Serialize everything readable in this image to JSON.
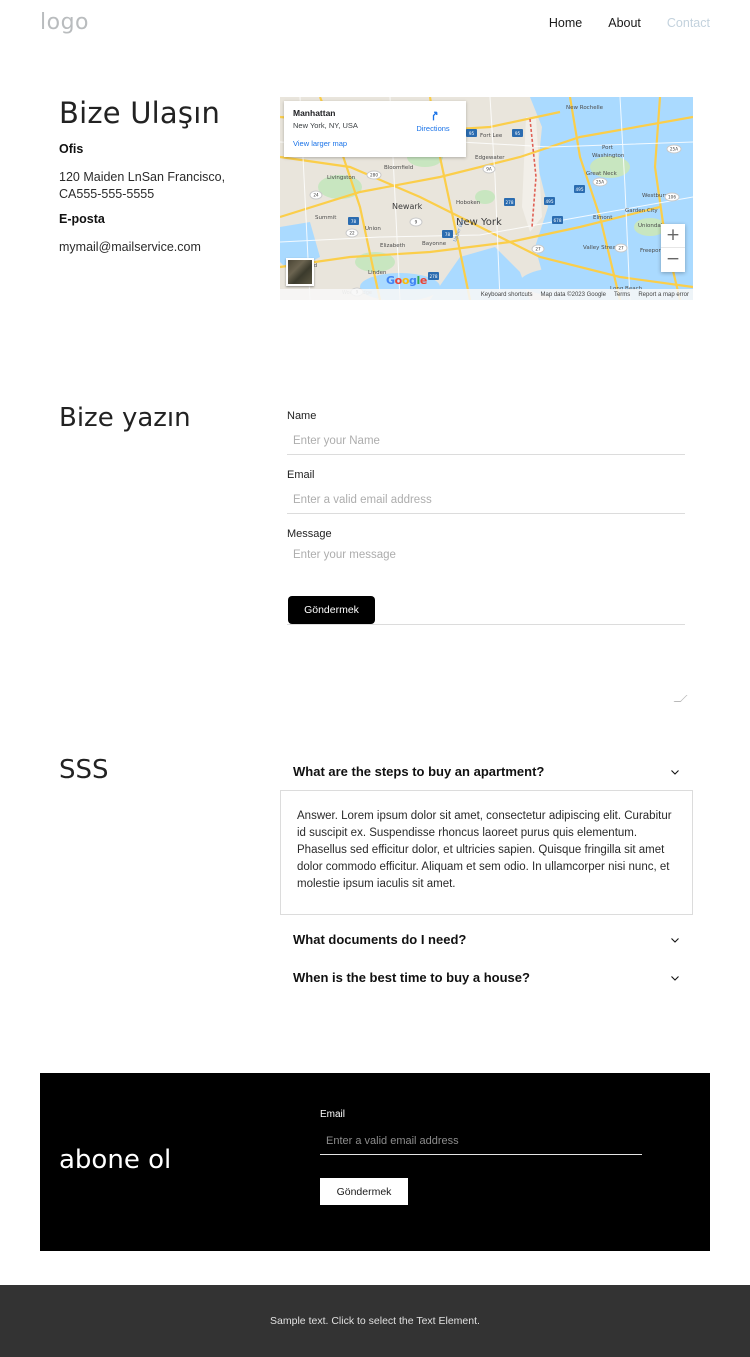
{
  "header": {
    "logo": "logo",
    "nav": [
      {
        "label": "Home",
        "muted": false
      },
      {
        "label": "About",
        "muted": false
      },
      {
        "label": "Contact",
        "muted": true
      }
    ]
  },
  "contact": {
    "heading": "Bize Ulaşın",
    "office_label": "Ofis",
    "address": "120 Maiden LnSan Francisco, CA555-555-5555",
    "email_label": "E-posta",
    "email": "mymail@mailservice.com"
  },
  "map": {
    "place_title": "Manhattan",
    "place_sub": "New York, NY, USA",
    "view_larger": "View larger map",
    "directions": "Directions",
    "zoom_in": "+",
    "zoom_out": "−",
    "google_wordmark": "Google",
    "attribution": [
      "Keyboard shortcuts",
      "Map data ©2023 Google",
      "Terms",
      "Report a map error"
    ]
  },
  "write_us": {
    "heading": "Bize yazın",
    "fields": [
      {
        "label": "Name",
        "placeholder": "Enter your Name"
      },
      {
        "label": "Email",
        "placeholder": "Enter a valid email address"
      },
      {
        "label": "Message",
        "placeholder": "Enter your message"
      }
    ],
    "submit_label": "Göndermek"
  },
  "faq": {
    "heading": "SSS",
    "items": [
      {
        "question": "What are the steps to buy an apartment?",
        "answer": "Answer. Lorem ipsum dolor sit amet, consectetur adipiscing elit. Curabitur id suscipit ex. Suspendisse rhoncus laoreet purus quis elementum. Phasellus sed efficitur dolor, et ultricies sapien. Quisque fringilla sit amet dolor commodo efficitur. Aliquam et sem odio. In ullamcorper nisi nunc, et molestie ipsum iaculis sit amet.",
        "expanded": true
      },
      {
        "question": "What documents do I need?",
        "answer": "",
        "expanded": false
      },
      {
        "question": "When is the best time to buy a house?",
        "answer": "",
        "expanded": false
      }
    ]
  },
  "newsletter": {
    "title": "abone ol",
    "email_label": "Email",
    "email_placeholder": "Enter a valid email address",
    "submit_label": "Göndermek"
  },
  "footer": {
    "text": "Sample text. Click to select the Text Element."
  },
  "colors": {
    "accent_link": "#1a73e8",
    "nav_muted": "#c3d2dd",
    "dark_block": "#000000",
    "footer_bg": "#333333"
  }
}
